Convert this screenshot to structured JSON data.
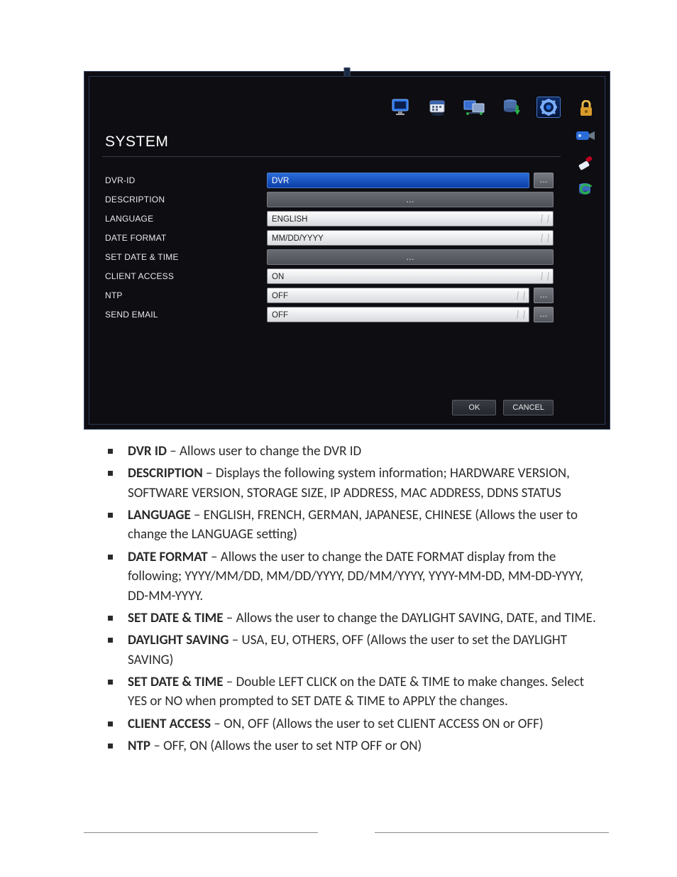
{
  "dvr": {
    "title": "SYSTEM",
    "rows": {
      "dvr_id": {
        "label": "DVR-ID",
        "value": "DVR"
      },
      "description": {
        "label": "DESCRIPTION",
        "value": "..."
      },
      "language": {
        "label": "LANGUAGE",
        "value": "ENGLISH"
      },
      "date_format": {
        "label": "DATE FORMAT",
        "value": "MM/DD/YYYY"
      },
      "set_datetime": {
        "label": "SET DATE & TIME",
        "value": "..."
      },
      "client_access": {
        "label": "CLIENT ACCESS",
        "value": "ON"
      },
      "ntp": {
        "label": "NTP",
        "value": "OFF"
      },
      "send_email": {
        "label": "SEND EMAIL",
        "value": "OFF"
      }
    },
    "more_label": "...",
    "ok_label": "OK",
    "cancel_label": "CANCEL"
  },
  "doc": {
    "items": [
      {
        "term": "DVR ID",
        "body": " – Allows user to change the DVR ID"
      },
      {
        "term": "DESCRIPTION",
        "body": " – Displays the following system information; HARDWARE VERSION, SOFTWARE VERSION, STORAGE SIZE, IP ADDRESS, MAC ADDRESS, DDNS STATUS"
      },
      {
        "term": "LANGUAGE",
        "body": " – ENGLISH, FRENCH, GERMAN, JAPANESE, CHINESE (Allows the user to change the LANGUAGE setting)"
      },
      {
        "term": "DATE FORMAT",
        "body": " – Allows the user to change the DATE FORMAT display from the following; YYYY/MM/DD, MM/DD/YYYY, DD/MM/YYYY, YYYY-MM-DD, MM-DD-YYYY, DD-MM-YYYY."
      },
      {
        "term": "SET DATE & TIME",
        "body": " – Allows the user to change the DAYLIGHT SAVING, DATE, and TIME."
      },
      {
        "term": "DAYLIGHT SAVING",
        "body": " – USA, EU, OTHERS, OFF (Allows the user to set the DAYLIGHT SAVING)"
      },
      {
        "term": "SET DATE & TIME",
        "body": " – Double LEFT CLICK on the DATE & TIME to make changes. Select YES or NO when prompted to SET DATE & TIME to APPLY the changes."
      },
      {
        "term": "CLIENT ACCESS",
        "body": " – ON, OFF (Allows the user to set CLIENT ACCESS ON or OFF)"
      },
      {
        "term": "NTP",
        "body": " – OFF, ON (Allows the user to set NTP OFF or ON)"
      }
    ]
  }
}
